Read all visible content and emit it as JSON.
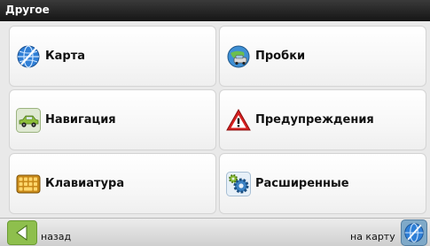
{
  "window": {
    "title": "Другое"
  },
  "menu": {
    "items": [
      {
        "label": "Карта",
        "icon": "globe-icon"
      },
      {
        "label": "Пробки",
        "icon": "traffic-icon"
      },
      {
        "label": "Навигация",
        "icon": "car-icon"
      },
      {
        "label": "Предупреждения",
        "icon": "warning-triangle-icon"
      },
      {
        "label": "Клавиатура",
        "icon": "keyboard-icon"
      },
      {
        "label": "Расширенные",
        "icon": "gears-icon"
      }
    ]
  },
  "bottom": {
    "back_label": "назад",
    "map_label": "на карту"
  },
  "colors": {
    "title_bar": "#1f1f1f",
    "background": "#e9e9e9",
    "back_button": "#8ebf4d",
    "globe": "#2f7fd6"
  }
}
